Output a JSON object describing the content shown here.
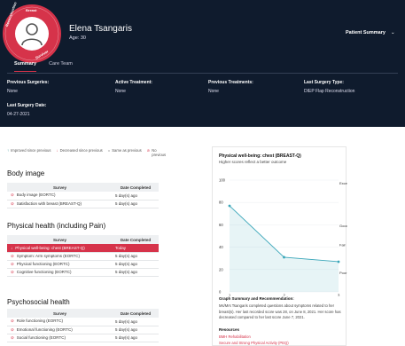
{
  "header": {
    "ring_top": "Breast",
    "ring_left": "Reconstruction",
    "ring_bottom": "Survivor",
    "patient_name": "Elena Tsangaris",
    "patient_age": "Age: 30",
    "view_selector": "Patient Summary",
    "tabs": [
      "Summary",
      "Care Team"
    ],
    "info": [
      {
        "label": "Previous Surgeries:",
        "value": "None"
      },
      {
        "label": "Active Treatment:",
        "value": "None"
      },
      {
        "label": "Previous Treatments:",
        "value": "None"
      },
      {
        "label": "Last Surgery Type:",
        "value": "DIEP Flap Reconstruction"
      },
      {
        "label": "Last Surgery Date:",
        "value": "04-27-2021"
      }
    ]
  },
  "legend": {
    "improved": "Improved since previous",
    "decreased": "Decreased since previous",
    "same": "Same as previous",
    "none_line1": "No",
    "none_line2": "previous"
  },
  "columns": {
    "survey": "Survey",
    "date": "Date Completed"
  },
  "sections": [
    {
      "title": "Body image",
      "rows": [
        {
          "survey": "Body image (EORTC)",
          "date": "5 day(s) ago"
        },
        {
          "survey": "Satisfaction with breast (BREAST-Q)",
          "date": "5 day(s) ago"
        }
      ]
    },
    {
      "title": "Physical health (including Pain)",
      "rows": [
        {
          "survey": "Physical well-being: chest (BREAST-Q)",
          "date": "Today"
        },
        {
          "survey": "Symptom: Arm symptoms (EORTC)",
          "date": "5 day(s) ago"
        },
        {
          "survey": "Physical functioning (EORTC)",
          "date": "5 day(s) ago"
        },
        {
          "survey": "Cognitive functioning (EORTC)",
          "date": "5 day(s) ago"
        }
      ]
    },
    {
      "title": "Psychosocial health",
      "rows": [
        {
          "survey": "Role functioning (EORTC)",
          "date": "5 day(s) ago"
        },
        {
          "survey": "Emotional functioning (EORTC)",
          "date": "5 day(s) ago"
        },
        {
          "survey": "Social functioning (EORTC)",
          "date": "5 day(s) ago"
        }
      ]
    }
  ],
  "chart_data": {
    "type": "area",
    "title": "Physical well-being: chest (BREAST-Q)",
    "subtitle": "Higher scores reflect a better outcome",
    "x": [
      1,
      2,
      3
    ],
    "values": [
      77,
      31,
      27
    ],
    "ylim": [
      0,
      100
    ],
    "yticks": [
      0,
      20,
      40,
      60,
      80,
      100
    ],
    "xticks": [
      1,
      2,
      3
    ],
    "bands": [
      "Excellent",
      "Good",
      "Fair",
      "Poor"
    ],
    "color": "#3aa6b9"
  },
  "summary": {
    "title": "Graph Summary and Recommendation:",
    "text": "Ms/Mrs Tsangaris completed questions about symptoms related to her breast(s). Her last recorded score was 28, on June 8, 2021. Her score has decreased compared to her last score June 7, 2021.",
    "resources_title": "Resources",
    "links": [
      "BMH Rehabilitation",
      "Secure and Strong Physical Activity (PEQ)"
    ]
  }
}
